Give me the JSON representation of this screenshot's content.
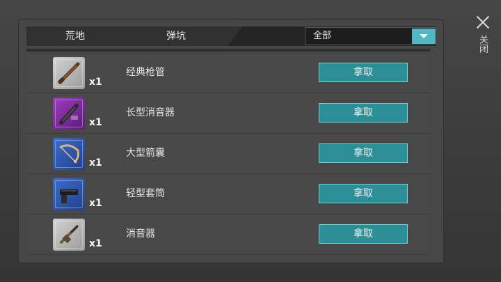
{
  "tabs": [
    "荒地",
    "弹坑"
  ],
  "filter": {
    "value": "全部"
  },
  "items": [
    {
      "name": "经典枪管",
      "qty": "x1",
      "rarity": "grey",
      "icon": "rifle-barrel-icon",
      "action": "拿取"
    },
    {
      "name": "长型消音器",
      "qty": "x1",
      "rarity": "purple",
      "icon": "long-silencer-icon",
      "action": "拿取"
    },
    {
      "name": "大型箭囊",
      "qty": "x1",
      "rarity": "blue",
      "icon": "quiver-icon",
      "action": "拿取"
    },
    {
      "name": "轻型套筒",
      "qty": "x1",
      "rarity": "blue",
      "icon": "pistol-slide-icon",
      "action": "拿取"
    },
    {
      "name": "消音器",
      "qty": "x1",
      "rarity": "grey",
      "icon": "silencer-icon",
      "action": "拿取"
    }
  ],
  "close": {
    "label": "关闭"
  },
  "colors": {
    "accent": "#2c8e97",
    "accent_border": "#6fd6de",
    "rarity_grey": "#b5b5b5",
    "rarity_purple": "#7b2a9e",
    "rarity_blue": "#3056b0"
  }
}
